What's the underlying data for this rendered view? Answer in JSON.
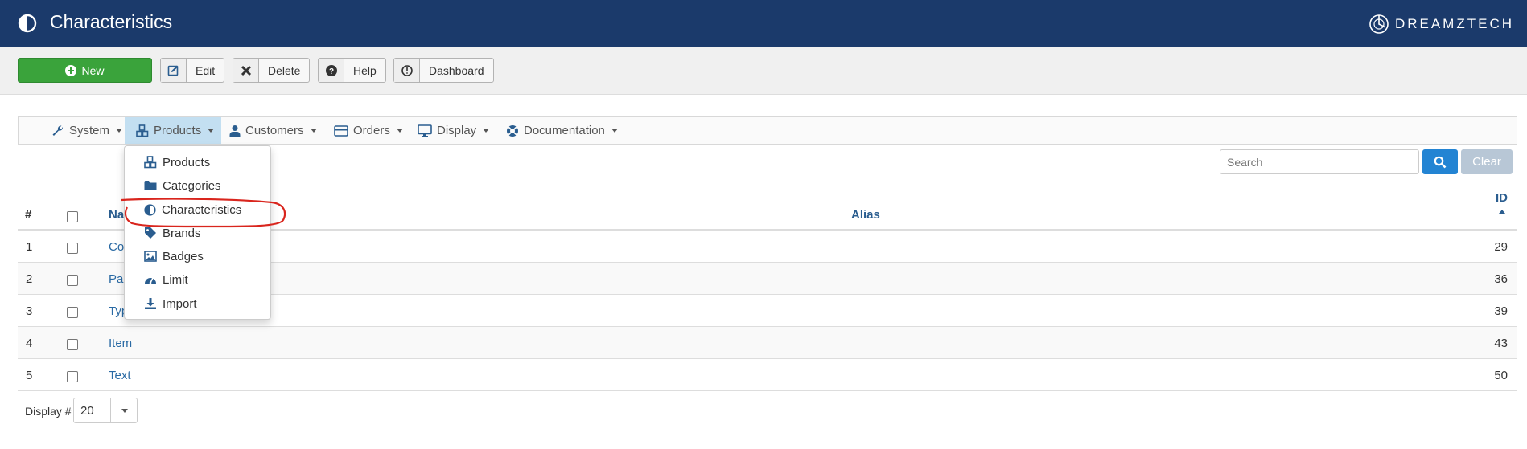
{
  "header": {
    "title": "Characteristics",
    "brand": "DREAMZTECH"
  },
  "toolbar": {
    "new_label": "New",
    "edit_label": "Edit",
    "delete_label": "Delete",
    "help_label": "Help",
    "dashboard_label": "Dashboard"
  },
  "nav": {
    "items": [
      {
        "label": "System",
        "icon": "wrench-icon"
      },
      {
        "label": "Products",
        "icon": "cubes-icon"
      },
      {
        "label": "Customers",
        "icon": "user-icon"
      },
      {
        "label": "Orders",
        "icon": "credit-card-icon"
      },
      {
        "label": "Display",
        "icon": "monitor-icon"
      },
      {
        "label": "Documentation",
        "icon": "life-ring-icon"
      }
    ],
    "active": "Products"
  },
  "dropdown": {
    "items": [
      {
        "label": "Products",
        "icon": "cubes-icon"
      },
      {
        "label": "Categories",
        "icon": "folder-icon"
      },
      {
        "label": "Characteristics",
        "icon": "contrast-icon"
      },
      {
        "label": "Brands",
        "icon": "tag-icon"
      },
      {
        "label": "Badges",
        "icon": "image-icon"
      },
      {
        "label": "Limit",
        "icon": "gauge-icon"
      },
      {
        "label": "Import",
        "icon": "download-icon"
      }
    ],
    "highlighted": "Characteristics"
  },
  "search": {
    "placeholder": "Search",
    "clear_label": "Clear"
  },
  "table": {
    "columns": {
      "num": "#",
      "name": "Na",
      "alias": "Alias",
      "id": "ID"
    },
    "rows": [
      {
        "num": "1",
        "name": "Co",
        "id": "29"
      },
      {
        "num": "2",
        "name": "Pa",
        "id": "36"
      },
      {
        "num": "3",
        "name": "Typ",
        "id": "39"
      },
      {
        "num": "4",
        "name": "Item",
        "id": "43"
      },
      {
        "num": "5",
        "name": "Text",
        "id": "50"
      }
    ]
  },
  "footer": {
    "display_label": "Display #",
    "display_value": "20"
  },
  "colors": {
    "header_bg": "#1b3a6b",
    "new_button": "#3aa33b",
    "nav_active": "#c3dff1",
    "search_button": "#2384d3",
    "annotation": "#d9251d"
  }
}
